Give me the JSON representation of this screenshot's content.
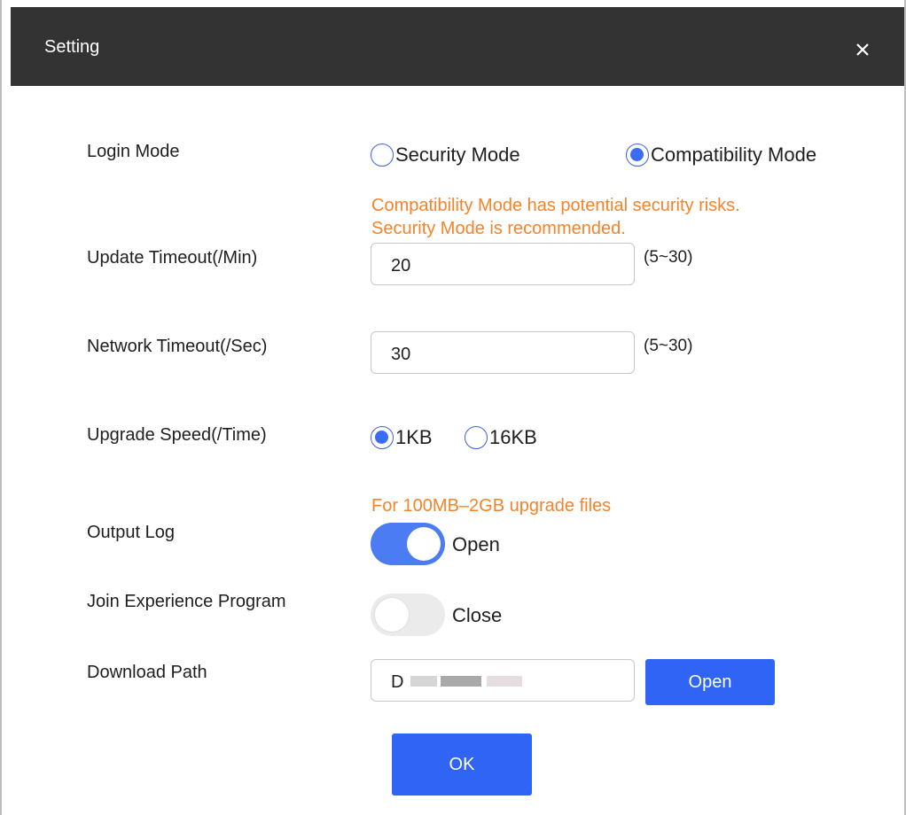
{
  "dialog": {
    "title": "Setting"
  },
  "login_mode": {
    "label": "Login Mode",
    "options": [
      "Security Mode",
      "Compatibility Mode"
    ],
    "selected": "Compatibility Mode",
    "warning_line1": "Compatibility Mode has potential security risks.",
    "warning_line2": "Security Mode is recommended."
  },
  "update_timeout": {
    "label": "Update Timeout(/Min)",
    "value": "20",
    "range": "(5~30)"
  },
  "network_timeout": {
    "label": "Network Timeout(/Sec)",
    "value": "30",
    "range": "(5~30)"
  },
  "upgrade_speed": {
    "label": "Upgrade Speed(/Time)",
    "options": [
      "1KB",
      "16KB"
    ],
    "selected": "1KB",
    "hint": "For 100MB–2GB upgrade files"
  },
  "output_log": {
    "label": "Output Log",
    "state": "Open",
    "enabled": true
  },
  "experience_program": {
    "label": "Join Experience Program",
    "state": "Close",
    "enabled": false
  },
  "download_path": {
    "label": "Download Path",
    "value": "D",
    "open_button": "Open"
  },
  "ok_button": "OK",
  "colors": {
    "titlebar": "#333333",
    "accent": "#2f64f5",
    "warning": "#f5832a",
    "toggle_on": "#4b7cf3",
    "toggle_off": "#ebebeb"
  }
}
